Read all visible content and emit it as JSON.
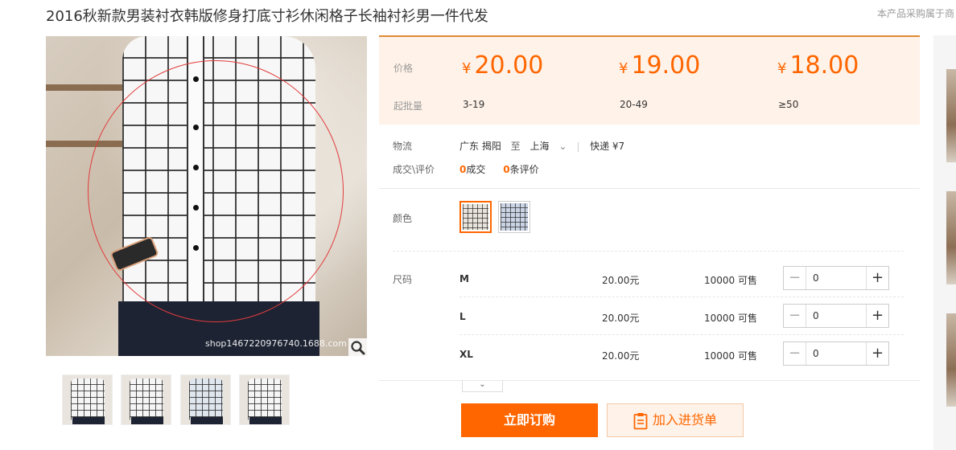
{
  "product": {
    "title": "2016秋新款男装衬衣韩版修身打底寸衫休闲格子长袖衬衫男一件代发",
    "corner_note": "本产品采购属于商"
  },
  "gallery": {
    "watermark": "shop1467220976740.1688.com",
    "zoom_icon": "magnifier-icon",
    "thumbnail_count": 4
  },
  "pricing": {
    "price_label": "价格",
    "moq_label": "起批量",
    "currency": "¥",
    "tiers": [
      {
        "price": "20.00",
        "range": "3-19"
      },
      {
        "price": "19.00",
        "range": "20-49"
      },
      {
        "price": "18.00",
        "range": "≥50"
      }
    ]
  },
  "logistics": {
    "label": "物流",
    "from": "广东 揭阳",
    "to_word": "至",
    "to": "上海",
    "shipping": "快递 ¥7"
  },
  "reviews": {
    "label": "成交\\评价",
    "deals_count": "0",
    "deals_text": "成交",
    "reviews_count": "0",
    "reviews_text": "条评价"
  },
  "color": {
    "label": "颜色"
  },
  "sizes": {
    "label": "尺码",
    "rows": [
      {
        "name": "M",
        "price": "20.00元",
        "stock": "10000 可售",
        "qty": "0"
      },
      {
        "name": "L",
        "price": "20.00元",
        "stock": "10000 可售",
        "qty": "0"
      },
      {
        "name": "XL",
        "price": "20.00元",
        "stock": "10000 可售",
        "qty": "0"
      }
    ]
  },
  "actions": {
    "order_label": "立即订购",
    "cart_label": "加入进货单"
  },
  "colors": {
    "accent": "#ff6600",
    "panel_bg": "#fff2e8"
  }
}
